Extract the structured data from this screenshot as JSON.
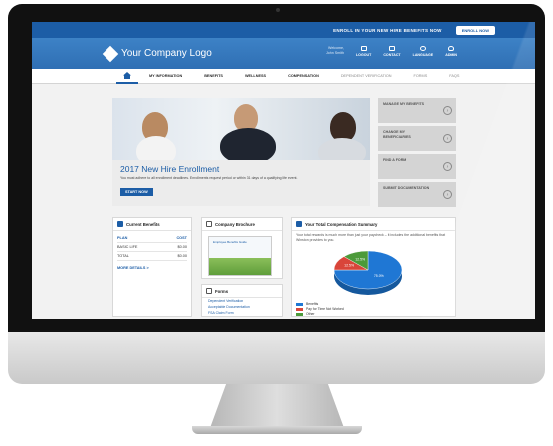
{
  "topbar": {
    "enroll_text": "ENROLL IN YOUR NEW HIRE BENEFITS NOW",
    "enroll_button": "ENROLL NOW"
  },
  "header": {
    "logo_text": "Your Company Logo",
    "welcome_line1": "Welcome,",
    "welcome_line2": "John Smith",
    "links": [
      "LOGOUT",
      "CONTACT",
      "LANGUAGE",
      "ADMIN"
    ]
  },
  "nav": {
    "items": [
      "MY INFORMATION",
      "BENEFITS",
      "WELLNESS",
      "COMPENSATION",
      "DEPENDENT VERIFICATION",
      "FORMS",
      "FAQS"
    ]
  },
  "hero": {
    "title": "2017 New Hire Enrollment",
    "text": "You must adhere to all enrollment deadlines. Enrollments request period or within 31 days of a qualifying life event.",
    "button": "START NOW"
  },
  "side_menu": [
    "MANAGE MY BENEFITS",
    "CHANGE MY BENEFICIARIES",
    "FIND A FORM",
    "SUBMIT DOCUMENTATION"
  ],
  "current_benefits": {
    "title": "Current Benefits",
    "col_plan": "PLAN",
    "col_cost": "COST",
    "rows": [
      {
        "plan": "BASIC LIFE",
        "cost": "$0.00"
      },
      {
        "plan": "TOTAL",
        "cost": "$0.00"
      }
    ],
    "more": "MORE DETAILS >"
  },
  "brochure": {
    "title": "Company Brochure",
    "cover": "Employee Benefits Guide"
  },
  "forms": {
    "title": "Forms",
    "links": [
      "Dependent Verification",
      "Acceptable Documentation",
      "FSA Claim Form"
    ]
  },
  "compensation": {
    "title": "Your Total Compensation Summary",
    "text": "Your total rewards is much more than just your paycheck – it includes the additional benefits that Winston provides to you.",
    "legend": [
      {
        "label": "Benefits",
        "color": "#1f77d4"
      },
      {
        "label": "Pay for Time Not Worked",
        "color": "#d9453a"
      },
      {
        "label": "Other",
        "color": "#4c9a3a"
      }
    ]
  },
  "chart_data": {
    "type": "pie",
    "title": "",
    "categories": [
      "Benefits",
      "Pay for Time Not Worked",
      "Other"
    ],
    "values": [
      75.0,
      12.5,
      12.5
    ],
    "labels": [
      "75.0%",
      "12.5%",
      "12.5%"
    ]
  }
}
